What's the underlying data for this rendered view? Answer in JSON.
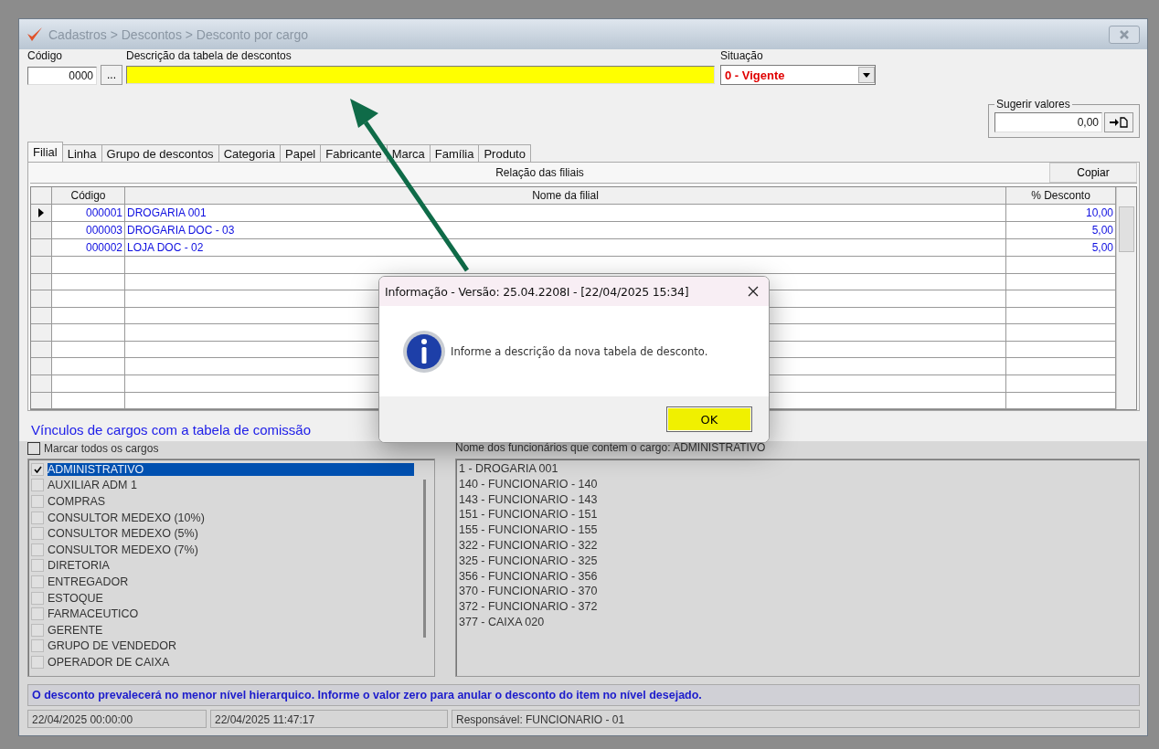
{
  "window": {
    "title": "Cadastros > Descontos > Desconto por cargo"
  },
  "header": {
    "code_label": "Código",
    "code_value": "0000",
    "lookup_button": "...",
    "description_label": "Descrição da tabela de descontos",
    "status_label": "Situação",
    "status_value": "0 - Vigente"
  },
  "suggest": {
    "legend": "Sugerir valores",
    "value": "0,00"
  },
  "tabs": [
    {
      "label": "Filial",
      "selected": true
    },
    {
      "label": "Linha",
      "selected": false
    },
    {
      "label": "Grupo de descontos",
      "selected": false
    },
    {
      "label": "Categoria",
      "selected": false
    },
    {
      "label": "Papel",
      "selected": false
    },
    {
      "label": "Fabricante",
      "selected": false
    },
    {
      "label": "Marca",
      "selected": false
    },
    {
      "label": "Família",
      "selected": false
    },
    {
      "label": "Produto",
      "selected": false
    }
  ],
  "grid": {
    "title": "Relação das filiais",
    "copy_button": "Copiar",
    "columns": [
      "Código",
      "Nome da filial",
      "% Desconto"
    ],
    "rows": [
      {
        "code": "000001",
        "name": "DROGARIA 001",
        "discount": "10,00",
        "selected": true
      },
      {
        "code": "000003",
        "name": "DROGARIA DOC - 03",
        "discount": "5,00",
        "selected": false
      },
      {
        "code": "000002",
        "name": "LOJA  DOC - 02",
        "discount": "5,00",
        "selected": false
      }
    ]
  },
  "roles": {
    "title": "Vínculos de cargos com a tabela de comissão",
    "mark_all": {
      "label": "Marcar todos os cargos",
      "checked": false
    },
    "items": [
      {
        "label": "ADMINISTRATIVO",
        "checked": true,
        "selected": true
      },
      {
        "label": "AUXILIAR ADM 1",
        "checked": false,
        "selected": false
      },
      {
        "label": "COMPRAS",
        "checked": false,
        "selected": false
      },
      {
        "label": "CONSULTOR MEDEXO (10%)",
        "checked": false,
        "selected": false
      },
      {
        "label": "CONSULTOR MEDEXO (5%)",
        "checked": false,
        "selected": false
      },
      {
        "label": "CONSULTOR MEDEXO (7%)",
        "checked": false,
        "selected": false
      },
      {
        "label": "DIRETORIA",
        "checked": false,
        "selected": false
      },
      {
        "label": "ENTREGADOR",
        "checked": false,
        "selected": false
      },
      {
        "label": "ESTOQUE",
        "checked": false,
        "selected": false
      },
      {
        "label": "FARMACEUTICO",
        "checked": false,
        "selected": false
      },
      {
        "label": "GERENTE",
        "checked": false,
        "selected": false
      },
      {
        "label": "GRUPO DE VENDEDOR",
        "checked": false,
        "selected": false
      },
      {
        "label": "OPERADOR DE CAIXA",
        "checked": false,
        "selected": false
      }
    ]
  },
  "employees": {
    "label": "Nome dos funcionários que contem o cargo: ADMINISTRATIVO",
    "items": [
      "1 - DROGARIA 001",
      "140 - FUNCIONARIO - 140",
      "143 - FUNCIONARIO - 143",
      "151 - FUNCIONARIO - 151",
      "155 - FUNCIONARIO - 155",
      "322 - FUNCIONARIO - 322",
      "325 - FUNCIONARIO - 325",
      "356 - FUNCIONARIO - 356",
      "370 - FUNCIONARIO - 370",
      "372 - FUNCIONARIO - 372",
      "377 - CAIXA 020"
    ]
  },
  "notice": "O desconto prevalecerá no menor nível hierarquico. Informe o valor zero para anular o desconto do item no nível desejado.",
  "status_bar": [
    "22/04/2025 00:00:00",
    "22/04/2025 11:47:17",
    "Responsável: FUNCIONARIO - 01"
  ],
  "dialog": {
    "title": "Informação - Versão: 25.04.2208I - [22/04/2025 15:34]",
    "message": "Informe a descrição da nova tabela de desconto.",
    "ok_button": "OK"
  }
}
